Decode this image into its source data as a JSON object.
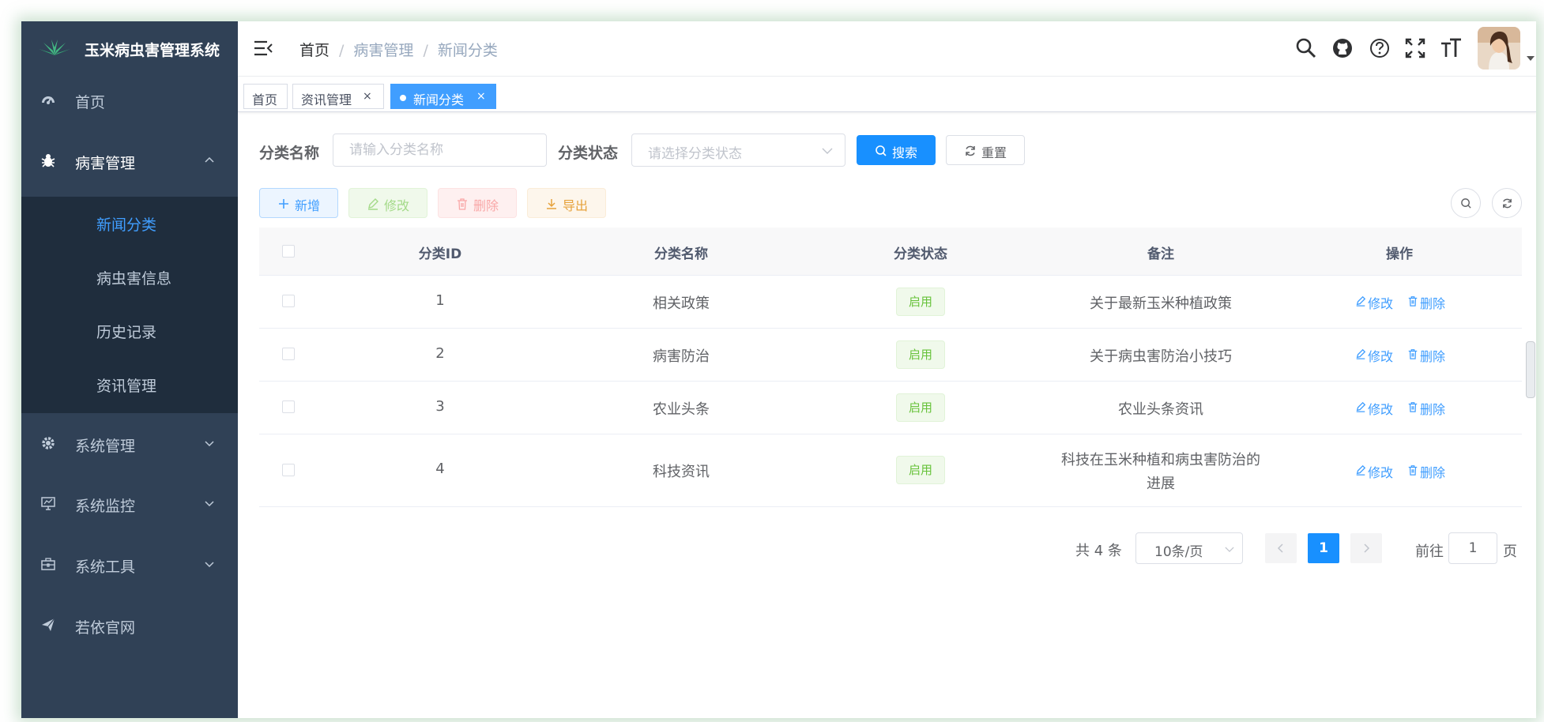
{
  "app": {
    "title": "玉米病虫害管理系统"
  },
  "sidebar": {
    "items": [
      {
        "label": "首页"
      },
      {
        "label": "病害管理"
      },
      {
        "label": "系统管理"
      },
      {
        "label": "系统监控"
      },
      {
        "label": "系统工具"
      },
      {
        "label": "若依官网"
      }
    ],
    "submenu": [
      {
        "label": "新闻分类"
      },
      {
        "label": "病虫害信息"
      },
      {
        "label": "历史记录"
      },
      {
        "label": "资讯管理"
      }
    ]
  },
  "navbar": {
    "breadcrumb": [
      "首页",
      "病害管理",
      "新闻分类"
    ],
    "separator": "/"
  },
  "tags": [
    {
      "label": "首页"
    },
    {
      "label": "资讯管理",
      "close": "×"
    },
    {
      "label": "新闻分类",
      "close": "×"
    }
  ],
  "search": {
    "name_label": "分类名称",
    "name_placeholder": "请输入分类名称",
    "status_label": "分类状态",
    "status_placeholder": "请选择分类状态",
    "search_button": "搜索",
    "reset_button": "重置"
  },
  "toolbar": {
    "add": "新增",
    "edit": "修改",
    "delete": "删除",
    "export": "导出"
  },
  "table": {
    "columns": [
      "分类ID",
      "分类名称",
      "分类状态",
      "备注",
      "操作"
    ],
    "rows": [
      {
        "id": "1",
        "name": "相关政策",
        "status": "启用",
        "remark": "关于最新玉米种植政策"
      },
      {
        "id": "2",
        "name": "病害防治",
        "status": "启用",
        "remark": "关于病虫害防治小技巧"
      },
      {
        "id": "3",
        "name": "农业头条",
        "status": "启用",
        "remark": "农业头条资讯"
      },
      {
        "id": "4",
        "name": "科技资讯",
        "status": "启用",
        "remark_line1": "科技在玉米种植和病虫害防治的",
        "remark_line2": "进展"
      }
    ],
    "actions": {
      "edit": "修改",
      "delete": "删除"
    }
  },
  "pagination": {
    "total": "共 4 条",
    "page_size": "10条/页",
    "current": "1",
    "goto_prefix": "前往",
    "goto_value": "1",
    "goto_suffix": "页"
  },
  "colors": {
    "sidebar_bg": "#304156",
    "submenu_bg": "#1f2d3d",
    "primary": "#409eff",
    "success": "#67c23a",
    "danger": "#f56c6c",
    "warning": "#e6a23c"
  }
}
